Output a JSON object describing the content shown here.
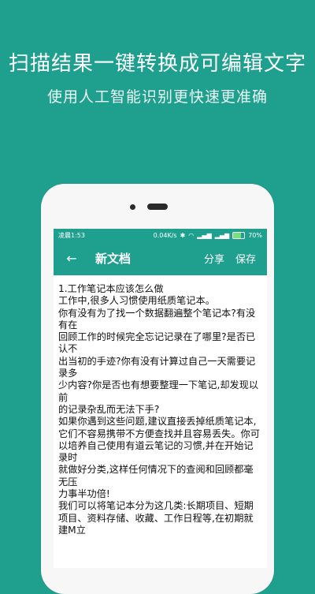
{
  "banner": {
    "headline": "扫描结果一键转换成可编辑文字",
    "subline": "使用人工智能识别更快速更准确"
  },
  "status_bar": {
    "time": "凌晨1:53",
    "network_speed": "0.04K/s",
    "battery_percent": "70%"
  },
  "app_bar": {
    "back_icon": "arrow-left-icon",
    "title": "新文档",
    "share_label": "分享",
    "save_label": "保存"
  },
  "document": {
    "lines": [
      "1.工作笔记本应该怎么做",
      "工作中,很多人习惯使用纸质笔记本。",
      "你有没有为了找一个数据翻遍整个笔记本?有没有在",
      "回顾工作的时候完全忘记记录在了哪里?是否已认不",
      "出当初的手迹?你有没有计算过自己一天需要记录多",
      "少内容?你是否也有想要整理一下笔记,却发现以前",
      "的记录杂乱而无法下手?",
      "如果你遇到这些问题,建议直接丢掉纸质笔记本,它们不容易携带不方便查找并且容易丢失。你可",
      "以培养自己使用有道云笔记的习惯,并在开始记录时",
      "就做好分类,这样任何情况下的查阅和回顾都毫无压",
      "力事半功倍!",
      "我们可以将笔记本分为这几类:长期项目、短期",
      "项目、资料存储、收藏、工作日程等,在初期就建M立"
    ]
  }
}
